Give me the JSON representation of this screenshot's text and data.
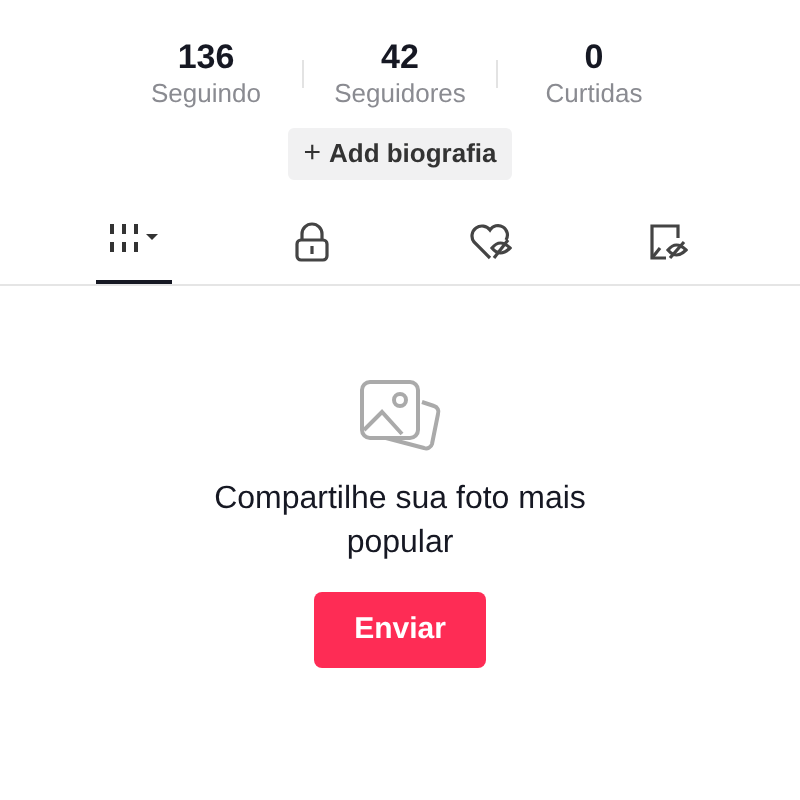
{
  "stats": [
    {
      "value": "136",
      "label": "Seguindo"
    },
    {
      "value": "42",
      "label": "Seguidores"
    },
    {
      "value": "0",
      "label": "Curtidas"
    }
  ],
  "bio_button": {
    "icon": "+",
    "label": "Add biografia"
  },
  "tabs": [
    {
      "kind": "grid",
      "selected": true
    },
    {
      "kind": "lock",
      "selected": false
    },
    {
      "kind": "heart",
      "selected": false
    },
    {
      "kind": "bookmark",
      "selected": false
    }
  ],
  "empty_state": {
    "message": "Compartilhe sua foto mais popular",
    "button": "Enviar"
  }
}
